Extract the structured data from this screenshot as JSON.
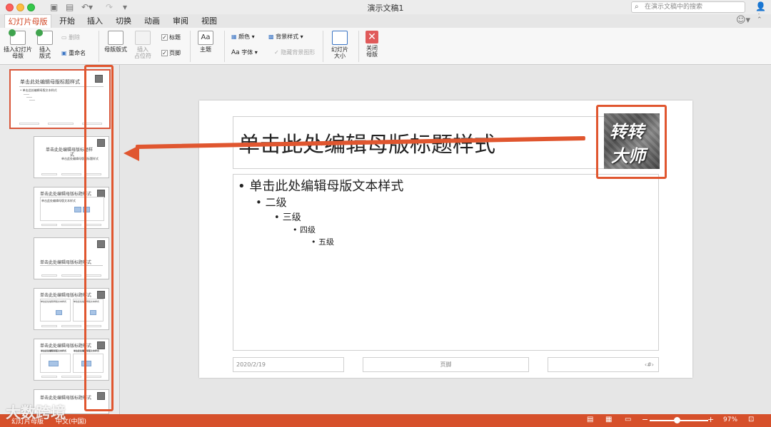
{
  "window": {
    "title": "演示文稿1"
  },
  "search": {
    "placeholder": "在演示文稿中的搜索"
  },
  "tabs": [
    {
      "label": "幻灯片母版"
    },
    {
      "label": "开始"
    },
    {
      "label": "插入"
    },
    {
      "label": "切换"
    },
    {
      "label": "动画"
    },
    {
      "label": "审阅"
    },
    {
      "label": "视图"
    }
  ],
  "ribbon": {
    "insert_master_line1": "插入幻灯片",
    "insert_master_line2": "母版",
    "insert_layout_line1": "插入",
    "insert_layout_line2": "版式",
    "delete": "删除",
    "rename": "重命名",
    "master_layout": "母版版式",
    "insert_placeholder_line1": "插入",
    "insert_placeholder_line2": "占位符",
    "title_check": "标题",
    "footer_check": "页脚",
    "theme": "主题",
    "theme_glyph": "Aa",
    "colors": "颜色",
    "fonts": "字体",
    "fonts_glyph": "Aa",
    "background_styles": "背景样式",
    "hide_background": "隐藏背景图形",
    "slide_size_line1": "幻灯片",
    "slide_size_line2": "大小",
    "close_master_line1": "关闭",
    "close_master_line2": "母版"
  },
  "thumbnails": {
    "master_title": "单击此处编辑母版标题样式",
    "master_body": "• 单击此处编辑母版文本样式",
    "layout_title": "单击此处编辑母版标题样式",
    "layout_title_wrap1": "单击此处编辑母版标题样",
    "layout_title_wrap2": "式",
    "layout_subtitle": "单击此处编辑母版副标题样式",
    "layout_body": "单击此处编辑母版文本样式",
    "layout_body_small": "单击此处编辑母版文本样式",
    "layout_body_small_b": "单击此处编辑母版文本样式",
    "layout_comp_title1": "单击此处编辑母版文本样式",
    "layout_comp_title2": "单击此处编辑母版文本样式"
  },
  "slide": {
    "title": "单击此处编辑母版标题样式",
    "level1": "• 单击此处编辑母版文本样式",
    "level2": "• 二级",
    "level3": "• 三级",
    "level4": "• 四级",
    "level5": "• 五级",
    "date": "2020/2/19",
    "footer": "页脚",
    "page_number": "‹#›",
    "logo_line1": "转转",
    "logo_line2": "大师"
  },
  "status": {
    "view": "幻灯片母版",
    "language": "中文(中国)",
    "zoom": "97%",
    "watermark": "大数跨境"
  },
  "colors": {
    "accent": "#d24726",
    "annotation": "#e0562f"
  }
}
